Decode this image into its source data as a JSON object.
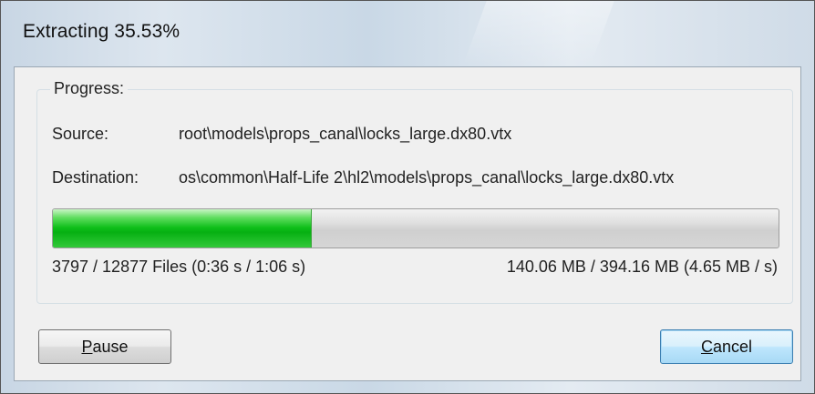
{
  "window": {
    "title": "Extracting 35.53%"
  },
  "group": {
    "label": "Progress:"
  },
  "source": {
    "label": "Source:",
    "value": "root\\models\\props_canal\\locks_large.dx80.vtx"
  },
  "destination": {
    "label": "Destination:",
    "value": "os\\common\\Half-Life 2\\hl2\\models\\props_canal\\locks_large.dx80.vtx"
  },
  "progress": {
    "fraction": 0.3553,
    "fill_color": "#0fbf1a"
  },
  "stats": {
    "files": "3797 / 12877 Files (0:36 s / 1:06 s)",
    "size": "140.06 MB / 394.16 MB (4.65 MB / s)"
  },
  "buttons": {
    "pause_label": "Pause",
    "cancel_label": "Cancel"
  }
}
